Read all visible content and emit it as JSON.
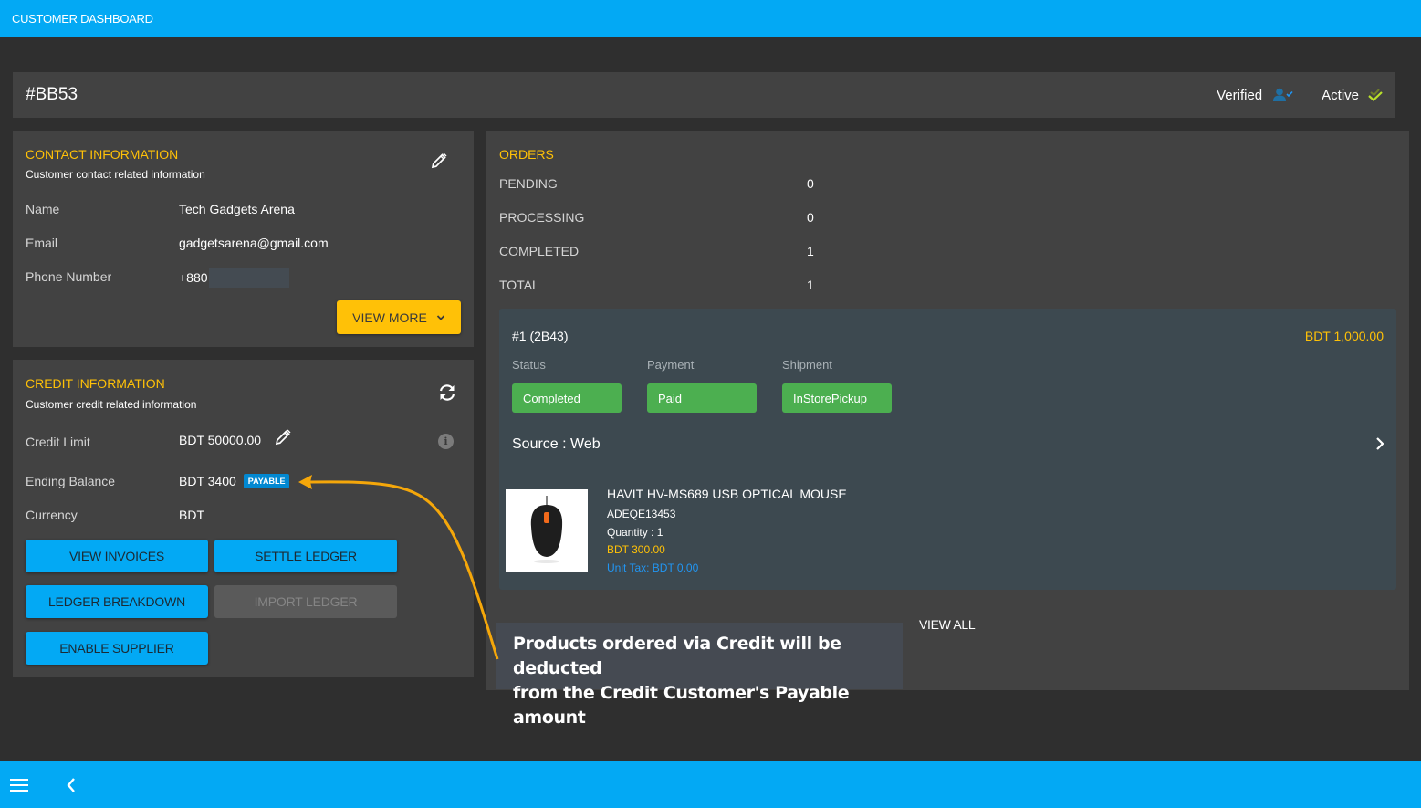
{
  "topbar": {
    "title": "CUSTOMER DASHBOARD"
  },
  "header": {
    "customer_id": "#BB53",
    "verified_label": "Verified",
    "verified_icon": "user-check-icon",
    "active_label": "Active",
    "active_icon": "double-check-icon"
  },
  "contact": {
    "title": "CONTACT INFORMATION",
    "subtitle": "Customer contact related information",
    "edit_icon": "pencil-icon",
    "fields": [
      {
        "label": "Name",
        "value": "Tech Gadgets Arena"
      },
      {
        "label": "Email",
        "value": "gadgetsarena@gmail.com"
      },
      {
        "label": "Phone Number",
        "value": "+880"
      }
    ],
    "view_more_label": "VIEW MORE",
    "view_more_icon": "chevron-down-icon"
  },
  "credit": {
    "title": "CREDIT INFORMATION",
    "subtitle": "Customer credit related information",
    "refresh_icon": "sync-icon",
    "credit_limit_label": "Credit Limit",
    "credit_limit_value": "BDT 50000.00",
    "info_icon": "info-icon",
    "ending_balance_label": "Ending Balance",
    "ending_balance_value": "BDT 3400",
    "ending_balance_badge": "PAYABLE",
    "currency_label": "Currency",
    "currency_value": "BDT",
    "buttons": {
      "view_invoices": "VIEW INVOICES",
      "settle_ledger": "SETTLE LEDGER",
      "ledger_breakdown": "LEDGER BREAKDOWN",
      "import_ledger": "IMPORT LEDGER",
      "enable_supplier": "ENABLE SUPPLIER"
    }
  },
  "orders": {
    "title": "ORDERS",
    "stats": [
      {
        "label": "PENDING",
        "value": "0"
      },
      {
        "label": "PROCESSING",
        "value": "0"
      },
      {
        "label": "COMPLETED",
        "value": "1"
      },
      {
        "label": "TOTAL",
        "value": "1"
      }
    ],
    "order": {
      "number": "#1 (2B43)",
      "total": "BDT 1,000.00",
      "status_label": "Status",
      "status_value": "Completed",
      "payment_label": "Payment",
      "payment_value": "Paid",
      "shipment_label": "Shipment",
      "shipment_value": "InStorePickup",
      "source": "Source : Web",
      "product": {
        "name": "HAVIT HV-MS689 USB OPTICAL MOUSE",
        "sku": "ADEQE13453",
        "quantity": "Quantity : 1",
        "price": "BDT 300.00",
        "unit_tax": "Unit Tax: BDT 0.00"
      }
    },
    "view_all_label": "VIEW ALL"
  },
  "annotation": {
    "text_line1": "Products ordered via Credit will be deducted",
    "text_line2": "from the Credit Customer's Payable amount",
    "arrow_color": "#f5a70a"
  },
  "bottombar": {
    "menu_icon": "hamburger-menu-icon",
    "back_icon": "chevron-left-icon"
  },
  "colors": {
    "primary": "#03a9f4",
    "accent": "#ffc107",
    "success": "#4caf50",
    "card_bg": "#424242",
    "page_bg": "#2f2f2f"
  }
}
